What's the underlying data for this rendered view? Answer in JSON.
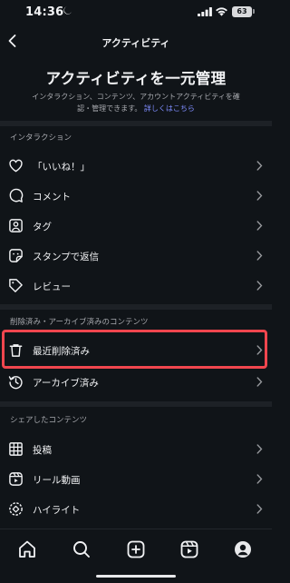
{
  "status_bar": {
    "time": "14:36",
    "battery": "63"
  },
  "header": {
    "title": "アクティビティ"
  },
  "intro": {
    "title": "アクティビティを一元管理",
    "description": "インタラクション、コンテンツ、アカウントアクティビティを確認・管理できます。",
    "link": "詳しくはこちら"
  },
  "sections": {
    "interactions": {
      "label": "インタラクション",
      "items": [
        {
          "label": "「いいね！」",
          "icon": "heart-icon"
        },
        {
          "label": "コメント",
          "icon": "comment-icon"
        },
        {
          "label": "タグ",
          "icon": "tag-icon"
        },
        {
          "label": "スタンプで返信",
          "icon": "sticker-icon"
        },
        {
          "label": "レビュー",
          "icon": "review-icon"
        }
      ]
    },
    "archived": {
      "label": "削除済み・アーカイブ済みのコンテンツ",
      "items": [
        {
          "label": "最近削除済み",
          "icon": "trash-icon"
        },
        {
          "label": "アーカイブ済み",
          "icon": "archive-icon"
        }
      ]
    },
    "shared": {
      "label": "シェアしたコンテンツ",
      "items": [
        {
          "label": "投稿",
          "icon": "grid-icon"
        },
        {
          "label": "リール動画",
          "icon": "reels-icon"
        },
        {
          "label": "ハイライト",
          "icon": "highlight-icon"
        }
      ]
    }
  },
  "bottom_nav": [
    "home-icon",
    "search-icon",
    "create-icon",
    "reels-icon",
    "profile-icon"
  ],
  "colors": {
    "background": "#101418",
    "highlight": "#f0464e",
    "link": "#7f8dff",
    "divider": "#1d2126"
  }
}
